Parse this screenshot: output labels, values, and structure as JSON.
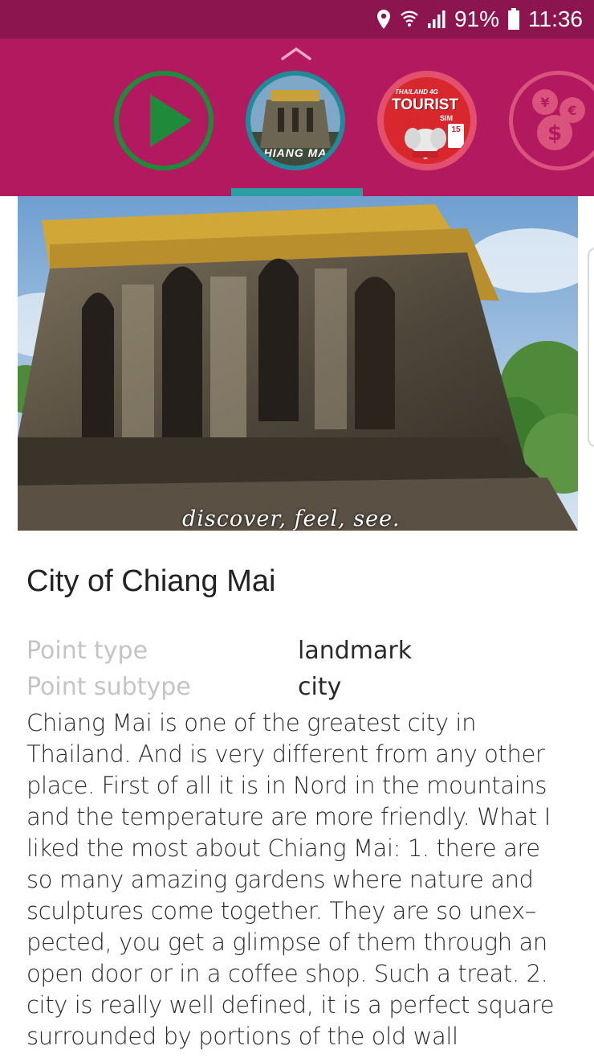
{
  "status_bar": {
    "battery": "91%",
    "time": "11:36",
    "icons": [
      "location-icon",
      "wifi-icon",
      "signal-icon",
      "battery-icon"
    ]
  },
  "header": {
    "background_color": "#b3195f",
    "carousel": [
      {
        "name": "play",
        "icon": "play-icon"
      },
      {
        "name": "chiang-mai",
        "label": "HIANG MA"
      },
      {
        "name": "tourist-sim",
        "label": "TOURIST",
        "sublabel": "SIM",
        "small": "THAILAND 4G",
        "badge": "15"
      },
      {
        "name": "currency",
        "icon": "currency-icon"
      }
    ]
  },
  "hero": {
    "caption": "discover, feel, see."
  },
  "point": {
    "title": "City of Chiang Mai",
    "properties": [
      {
        "label": "Point type",
        "value": "landmark"
      },
      {
        "label": "Point subtype",
        "value": "city"
      }
    ],
    "description": "Chiang Mai is one of the greatest city in Thailand. And is very different from any other place. First of all it is in Nord in the mountains and the temperature are more friendly. What I liked the most about Chiang Mai: 1. there are so many amazing gardens where nature and sculptures come together. They are so unex–pected, you get a glimpse of them through an open door or in a coffee shop. Such a treat. 2. city is really well defined, it is a perfect square surrounded by portions of the old wall"
  }
}
